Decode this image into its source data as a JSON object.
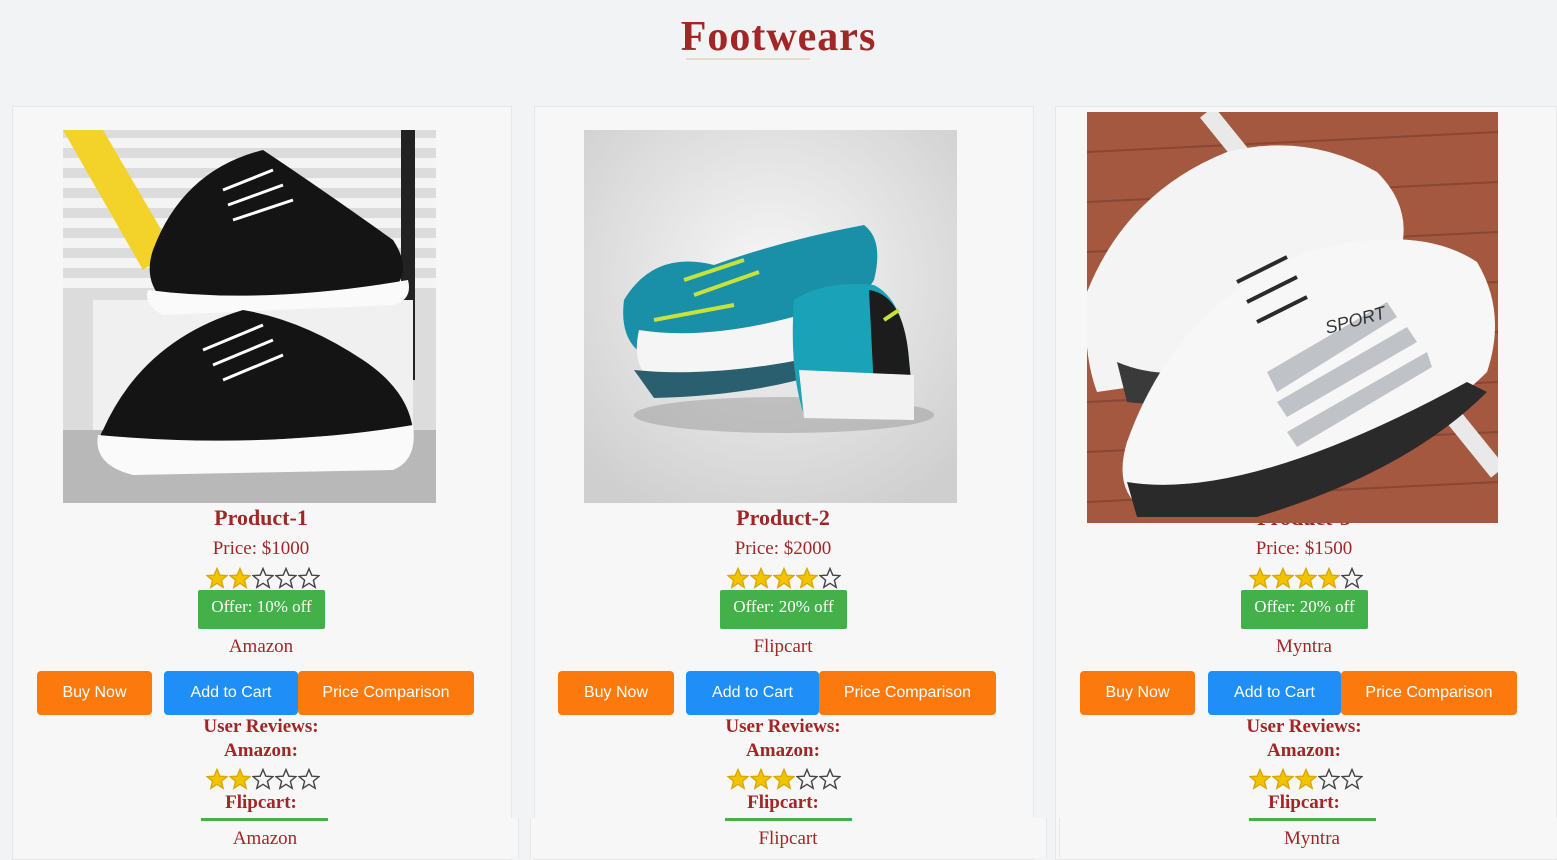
{
  "page": {
    "title": "Footwears"
  },
  "products": [
    {
      "name": "Product-1",
      "price": "Price: $1000",
      "rating": 2,
      "offer": "Offer: 10% off",
      "seller": "Amazon",
      "buttons": {
        "buy": "Buy Now",
        "cart": "Add to Cart",
        "compare": "Price Comparison"
      },
      "reviews": {
        "heading": "User Reviews:",
        "source1": "Amazon:",
        "rating1": 2,
        "source2": "Flipcart:"
      },
      "footer_seller": "Amazon",
      "image": "black-sneakers-image"
    },
    {
      "name": "Product-2",
      "price": "Price: $2000",
      "rating": 4,
      "offer": "Offer: 20% off",
      "seller": "Flipcart",
      "buttons": {
        "buy": "Buy Now",
        "cart": "Add to Cart",
        "compare": "Price Comparison"
      },
      "reviews": {
        "heading": "User Reviews:",
        "source1": "Amazon:",
        "rating1": 3,
        "source2": "Flipcart:"
      },
      "footer_seller": "Flipcart",
      "image": "teal-running-shoes-image"
    },
    {
      "name": "Product-3",
      "price": "Price: $1500",
      "rating": 4,
      "offer": "Offer: 20% off",
      "seller": "Myntra",
      "buttons": {
        "buy": "Buy Now",
        "cart": "Add to Cart",
        "compare": "Price Comparison"
      },
      "reviews": {
        "heading": "User Reviews:",
        "source1": "Amazon:",
        "rating1": 3,
        "source2": "Flipcart:"
      },
      "footer_seller": "Myntra",
      "image": "white-sport-shoes-image"
    }
  ],
  "colors": {
    "accent": "#a32626",
    "offer_green": "#44b04a",
    "button_orange": "#fc7a0d",
    "button_blue": "#1f8ef7",
    "star_gold": "#f2c400"
  }
}
